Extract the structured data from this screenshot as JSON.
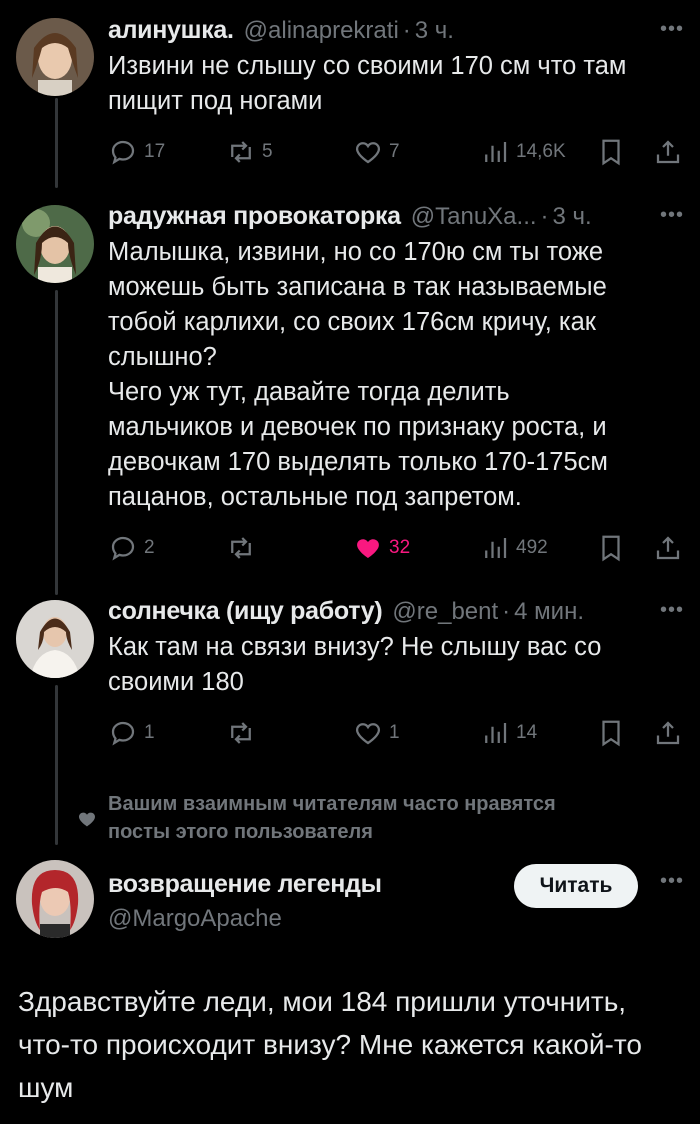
{
  "tweets": [
    {
      "name": "алинушка.",
      "handle": "@alinaprekrati",
      "time": "3 ч.",
      "text": "Извини не слышу со своими 170 см что там\nпищит под ногами",
      "replies": "17",
      "retweets": "5",
      "likes": "7",
      "views": "14,6K"
    },
    {
      "name": "радужная провокаторка",
      "handle": "@TanuXa...",
      "time": "3 ч.",
      "text": "Малышка, извини, но со 170ю см ты тоже\nможешь быть записана в так называемые\nтобой карлихи, со своих 176см кричу, как\nслышно?\nЧего уж тут, давайте тогда делить\nмальчиков и девочек по признаку роста, и\nдевочкам 170 выделять только 170-175см\nпацанов, остальные под запретом.",
      "replies": "2",
      "retweets": "",
      "likes": "32",
      "views": "492"
    },
    {
      "name": "солнечка (ищу работу)",
      "handle": "@re_bent",
      "time": "4 мин.",
      "text": "Как там на связи внизу? Не слышу вас со\nсвоими 180",
      "replies": "1",
      "retweets": "",
      "likes": "1",
      "views": "14"
    }
  ],
  "suggestion": "Вашим взаимным читателям часто нравятся\nпосты этого пользователя",
  "main": {
    "name": "возвращение легенды",
    "handle": "@MargoApache",
    "follow_label": "Читать",
    "text": "Здравствуйте леди, мои 184 пришли уточнить, что-то происходит внизу? Мне кажется какой-то шум"
  },
  "colors": {
    "background": "#000000",
    "text": "#e7e9ea",
    "muted": "#71767b",
    "like": "#f91880"
  }
}
